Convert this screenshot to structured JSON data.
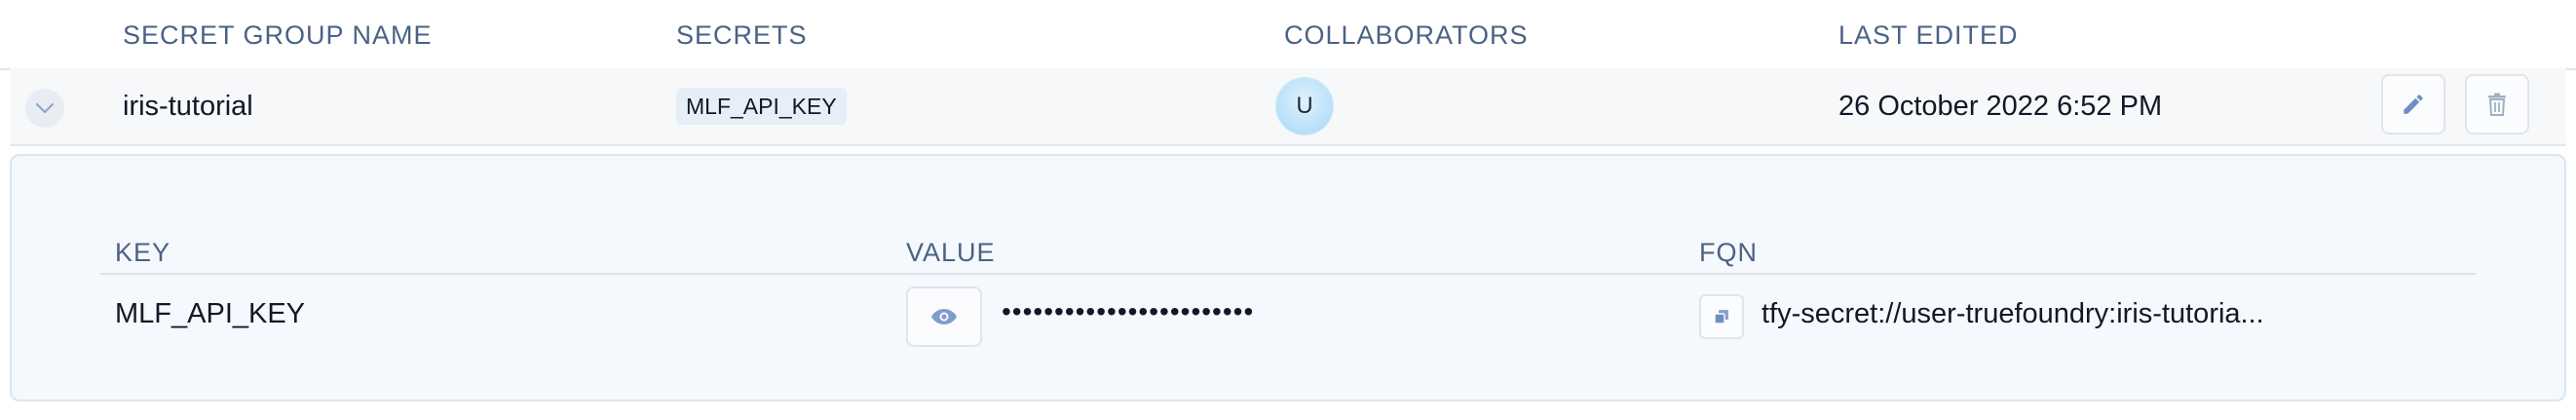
{
  "table": {
    "columns": {
      "name": "SECRET GROUP NAME",
      "secrets": "SECRETS",
      "collaborators": "COLLABORATORS",
      "last_edited": "LAST EDITED"
    },
    "rows": [
      {
        "name": "iris-tutorial",
        "secrets": [
          "MLF_API_KEY"
        ],
        "collaborator_initial": "U",
        "last_edited": "26 October 2022 6:52 PM",
        "expanded": true,
        "details": {
          "columns": {
            "key": "KEY",
            "value": "VALUE",
            "fqn": "FQN"
          },
          "items": [
            {
              "key": "MLF_API_KEY",
              "masked_value": "••••••••••••••••••••••••",
              "fqn": "tfy-secret://user-truefoundry:iris-tutoria..."
            }
          ]
        }
      }
    ]
  },
  "icons": {
    "expand": "chevron-down-icon",
    "edit": "pencil-icon",
    "delete": "trash-icon",
    "reveal": "eye-icon",
    "copy": "copy-icon"
  },
  "colors": {
    "header_text": "#4a6285",
    "icon": "#6f8fbf",
    "panel_bg": "#f5f8fc",
    "chip_bg": "#e6eef8"
  }
}
